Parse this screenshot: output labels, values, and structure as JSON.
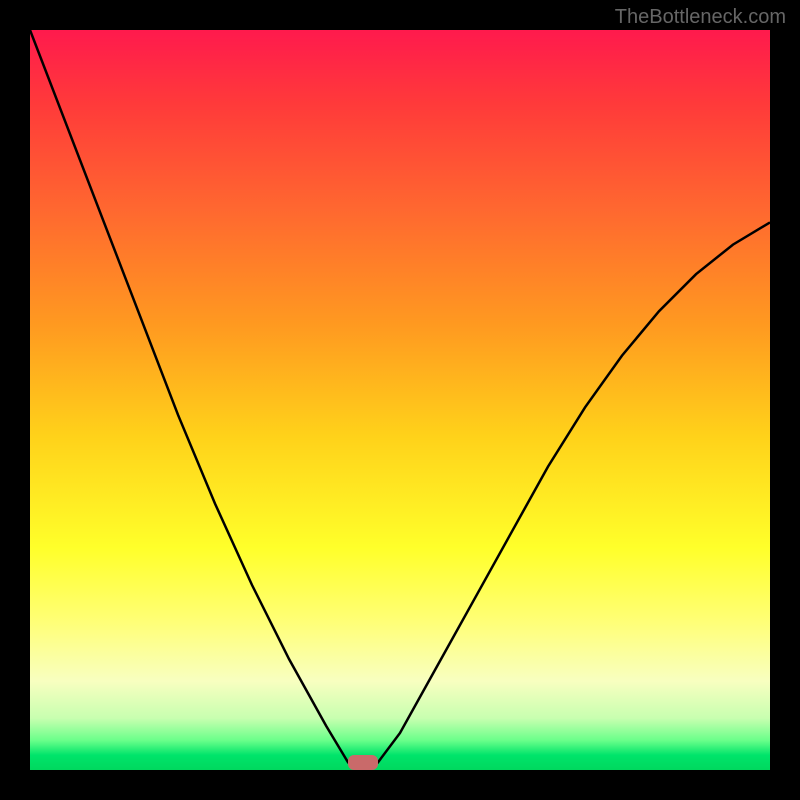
{
  "watermark": "TheBottleneck.com",
  "chart_data": {
    "type": "line",
    "title": "",
    "xlabel": "",
    "ylabel": "",
    "xlim": [
      0,
      100
    ],
    "ylim": [
      0,
      100
    ],
    "series": [
      {
        "name": "bottleneck-curve",
        "x": [
          0,
          5,
          10,
          15,
          20,
          25,
          30,
          35,
          40,
          43,
          45,
          47,
          50,
          55,
          60,
          65,
          70,
          75,
          80,
          85,
          90,
          95,
          100
        ],
        "values": [
          100,
          87,
          74,
          61,
          48,
          36,
          25,
          15,
          6,
          1,
          0,
          1,
          5,
          14,
          23,
          32,
          41,
          49,
          56,
          62,
          67,
          71,
          74
        ]
      }
    ],
    "marker": {
      "x": 45,
      "y": 0,
      "width": 4,
      "height": 2
    },
    "gradient_colors": {
      "top": "#ff1a4d",
      "mid": "#ffd21a",
      "bottom": "#00d85e"
    }
  }
}
